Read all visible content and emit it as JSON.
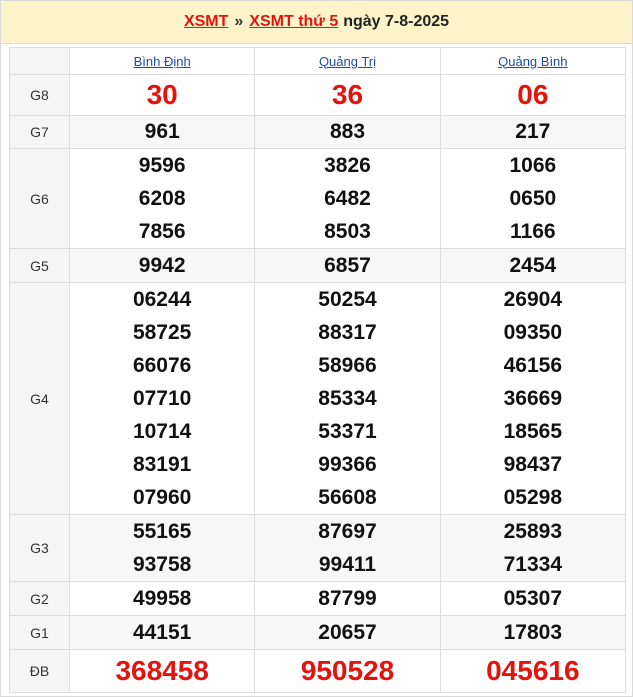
{
  "header": {
    "link1": "XSMT",
    "separator": "»",
    "link2": "XSMT thứ 5",
    "date": "ngày 7-8-2025"
  },
  "provinces": [
    "Bình Định",
    "Quảng Trị",
    "Quảng Bình"
  ],
  "prizes": [
    {
      "label": "G8",
      "values": [
        [
          "30"
        ],
        [
          "36"
        ],
        [
          "06"
        ]
      ]
    },
    {
      "label": "G7",
      "values": [
        [
          "961"
        ],
        [
          "883"
        ],
        [
          "217"
        ]
      ]
    },
    {
      "label": "G6",
      "values": [
        [
          "9596",
          "6208",
          "7856"
        ],
        [
          "3826",
          "6482",
          "8503"
        ],
        [
          "1066",
          "0650",
          "1166"
        ]
      ]
    },
    {
      "label": "G5",
      "values": [
        [
          "9942"
        ],
        [
          "6857"
        ],
        [
          "2454"
        ]
      ]
    },
    {
      "label": "G4",
      "values": [
        [
          "06244",
          "58725",
          "66076",
          "07710",
          "10714",
          "83191",
          "07960"
        ],
        [
          "50254",
          "88317",
          "58966",
          "85334",
          "53371",
          "99366",
          "56608"
        ],
        [
          "26904",
          "09350",
          "46156",
          "36669",
          "18565",
          "98437",
          "05298"
        ]
      ]
    },
    {
      "label": "G3",
      "values": [
        [
          "55165",
          "93758"
        ],
        [
          "87697",
          "99411"
        ],
        [
          "25893",
          "71334"
        ]
      ]
    },
    {
      "label": "G2",
      "values": [
        [
          "49958"
        ],
        [
          "87799"
        ],
        [
          "05307"
        ]
      ]
    },
    {
      "label": "G1",
      "values": [
        [
          "44151"
        ],
        [
          "20657"
        ],
        [
          "17803"
        ]
      ]
    },
    {
      "label": "ĐB",
      "values": [
        [
          "368458"
        ],
        [
          "950528"
        ],
        [
          "045616"
        ]
      ]
    }
  ]
}
